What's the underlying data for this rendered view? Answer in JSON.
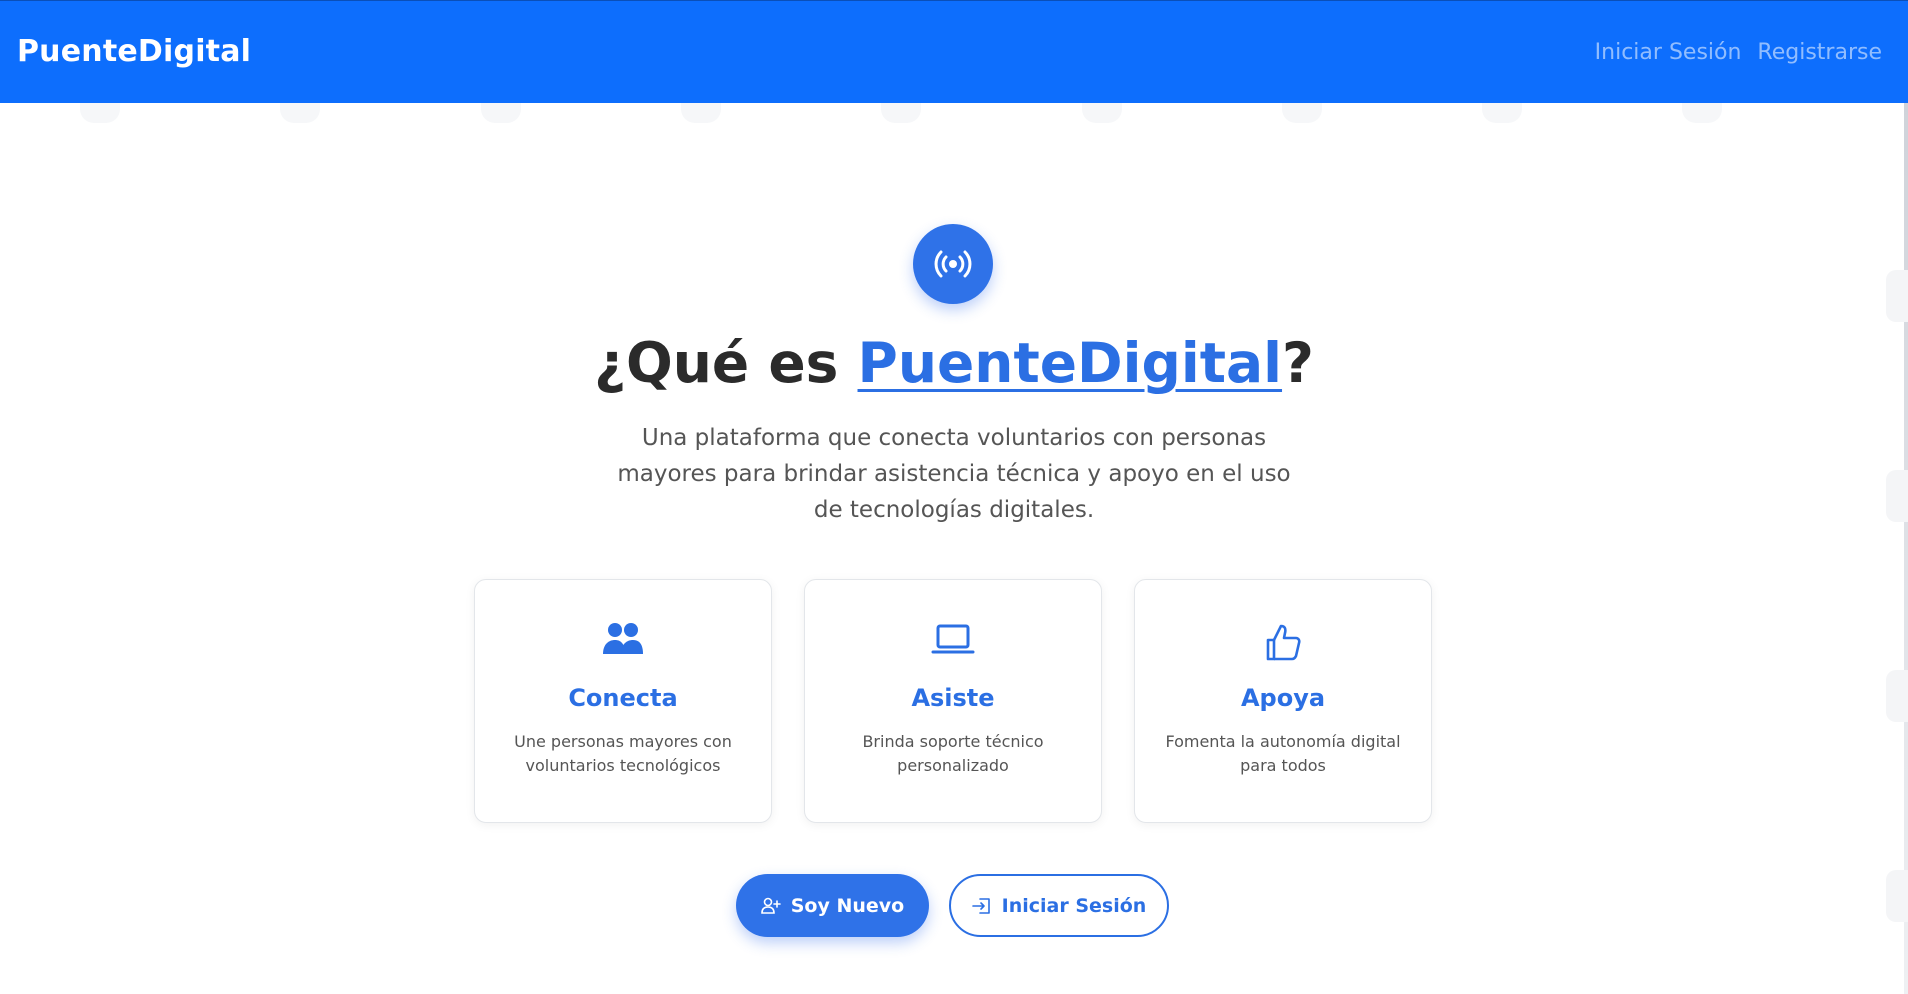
{
  "navbar": {
    "brand": "PuenteDigital",
    "links": [
      {
        "label": "Iniciar Sesión"
      },
      {
        "label": "Registrarse"
      }
    ],
    "background": "#0d6efd"
  },
  "hero": {
    "icon": "broadcast-icon",
    "title_prefix": "¿Qué es ",
    "title_brand": "PuenteDigital",
    "title_suffix": "?",
    "description": "Una plataforma que conecta voluntarios con personas mayores para brindar asistencia técnica y apoyo en el uso de tecnologías digitales."
  },
  "features": [
    {
      "icon": "people-icon",
      "title": "Conecta",
      "description": "Une personas mayores con voluntarios tecnológicos"
    },
    {
      "icon": "laptop-icon",
      "title": "Asiste",
      "description": "Brinda soporte técnico personalizado"
    },
    {
      "icon": "thumbs-up-icon",
      "title": "Apoya",
      "description": "Fomenta la autonomía digital para todos"
    }
  ],
  "actions": {
    "new_user": {
      "label": "Soy Nuevo",
      "icon": "person-plus-icon"
    },
    "login": {
      "label": "Iniciar Sesión",
      "icon": "sign-in-icon"
    }
  },
  "colors": {
    "accent": "#2b6fe3",
    "text": "#2b2b2b"
  }
}
